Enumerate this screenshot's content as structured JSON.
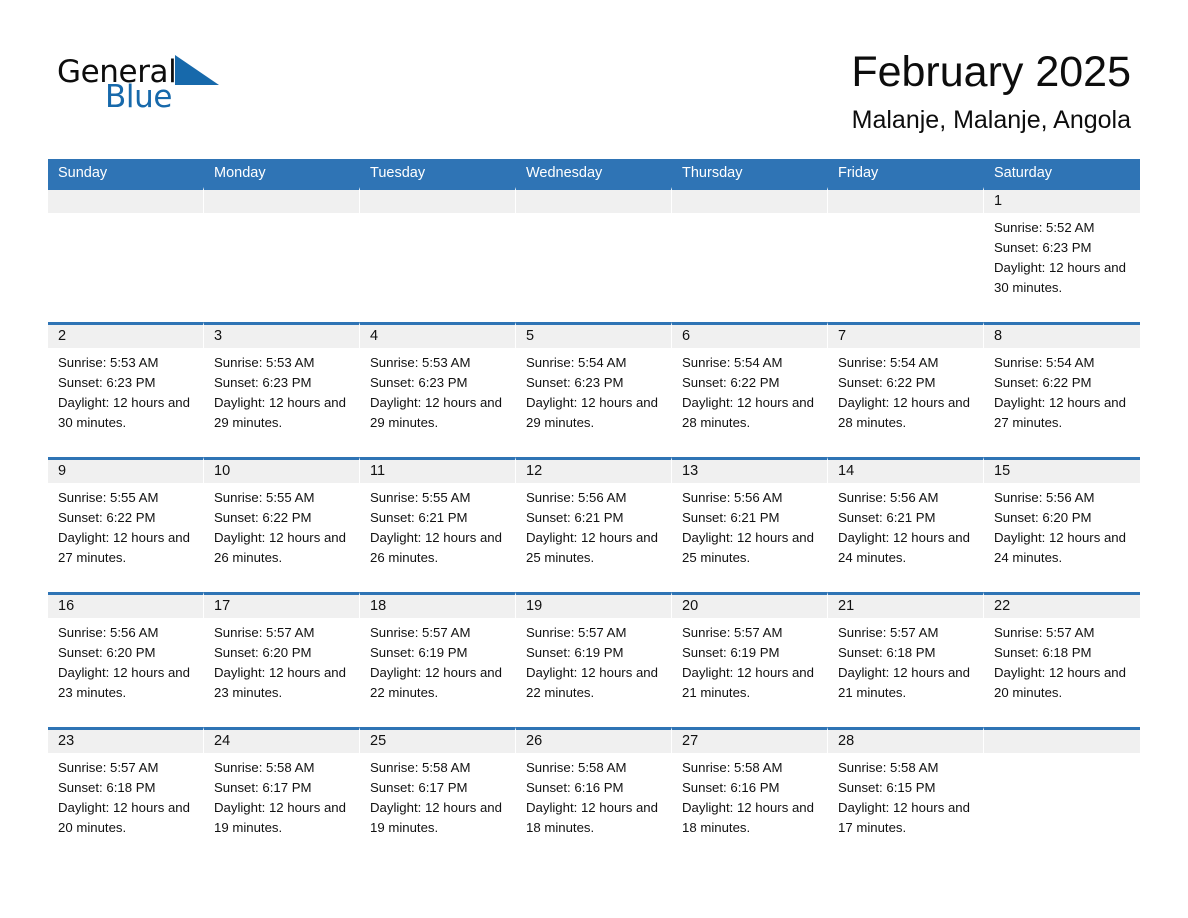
{
  "brand": {
    "name_part1": "General",
    "name_part2": "Blue",
    "triangle_color": "#1769ab"
  },
  "header": {
    "month_title": "February 2025",
    "location": "Malanje, Malanje, Angola"
  },
  "theme": {
    "header_blue": "#2f74b5",
    "day_band_gray": "#f0f0f0",
    "text_color": "#111111"
  },
  "weekdays": [
    "Sunday",
    "Monday",
    "Tuesday",
    "Wednesday",
    "Thursday",
    "Friday",
    "Saturday"
  ],
  "weeks": [
    [
      {
        "day": "",
        "sunrise": "",
        "sunset": "",
        "daylight": ""
      },
      {
        "day": "",
        "sunrise": "",
        "sunset": "",
        "daylight": ""
      },
      {
        "day": "",
        "sunrise": "",
        "sunset": "",
        "daylight": ""
      },
      {
        "day": "",
        "sunrise": "",
        "sunset": "",
        "daylight": ""
      },
      {
        "day": "",
        "sunrise": "",
        "sunset": "",
        "daylight": ""
      },
      {
        "day": "",
        "sunrise": "",
        "sunset": "",
        "daylight": ""
      },
      {
        "day": "1",
        "sunrise": "Sunrise: 5:52 AM",
        "sunset": "Sunset: 6:23 PM",
        "daylight": "Daylight: 12 hours and 30 minutes."
      }
    ],
    [
      {
        "day": "2",
        "sunrise": "Sunrise: 5:53 AM",
        "sunset": "Sunset: 6:23 PM",
        "daylight": "Daylight: 12 hours and 30 minutes."
      },
      {
        "day": "3",
        "sunrise": "Sunrise: 5:53 AM",
        "sunset": "Sunset: 6:23 PM",
        "daylight": "Daylight: 12 hours and 29 minutes."
      },
      {
        "day": "4",
        "sunrise": "Sunrise: 5:53 AM",
        "sunset": "Sunset: 6:23 PM",
        "daylight": "Daylight: 12 hours and 29 minutes."
      },
      {
        "day": "5",
        "sunrise": "Sunrise: 5:54 AM",
        "sunset": "Sunset: 6:23 PM",
        "daylight": "Daylight: 12 hours and 29 minutes."
      },
      {
        "day": "6",
        "sunrise": "Sunrise: 5:54 AM",
        "sunset": "Sunset: 6:22 PM",
        "daylight": "Daylight: 12 hours and 28 minutes."
      },
      {
        "day": "7",
        "sunrise": "Sunrise: 5:54 AM",
        "sunset": "Sunset: 6:22 PM",
        "daylight": "Daylight: 12 hours and 28 minutes."
      },
      {
        "day": "8",
        "sunrise": "Sunrise: 5:54 AM",
        "sunset": "Sunset: 6:22 PM",
        "daylight": "Daylight: 12 hours and 27 minutes."
      }
    ],
    [
      {
        "day": "9",
        "sunrise": "Sunrise: 5:55 AM",
        "sunset": "Sunset: 6:22 PM",
        "daylight": "Daylight: 12 hours and 27 minutes."
      },
      {
        "day": "10",
        "sunrise": "Sunrise: 5:55 AM",
        "sunset": "Sunset: 6:22 PM",
        "daylight": "Daylight: 12 hours and 26 minutes."
      },
      {
        "day": "11",
        "sunrise": "Sunrise: 5:55 AM",
        "sunset": "Sunset: 6:21 PM",
        "daylight": "Daylight: 12 hours and 26 minutes."
      },
      {
        "day": "12",
        "sunrise": "Sunrise: 5:56 AM",
        "sunset": "Sunset: 6:21 PM",
        "daylight": "Daylight: 12 hours and 25 minutes."
      },
      {
        "day": "13",
        "sunrise": "Sunrise: 5:56 AM",
        "sunset": "Sunset: 6:21 PM",
        "daylight": "Daylight: 12 hours and 25 minutes."
      },
      {
        "day": "14",
        "sunrise": "Sunrise: 5:56 AM",
        "sunset": "Sunset: 6:21 PM",
        "daylight": "Daylight: 12 hours and 24 minutes."
      },
      {
        "day": "15",
        "sunrise": "Sunrise: 5:56 AM",
        "sunset": "Sunset: 6:20 PM",
        "daylight": "Daylight: 12 hours and 24 minutes."
      }
    ],
    [
      {
        "day": "16",
        "sunrise": "Sunrise: 5:56 AM",
        "sunset": "Sunset: 6:20 PM",
        "daylight": "Daylight: 12 hours and 23 minutes."
      },
      {
        "day": "17",
        "sunrise": "Sunrise: 5:57 AM",
        "sunset": "Sunset: 6:20 PM",
        "daylight": "Daylight: 12 hours and 23 minutes."
      },
      {
        "day": "18",
        "sunrise": "Sunrise: 5:57 AM",
        "sunset": "Sunset: 6:19 PM",
        "daylight": "Daylight: 12 hours and 22 minutes."
      },
      {
        "day": "19",
        "sunrise": "Sunrise: 5:57 AM",
        "sunset": "Sunset: 6:19 PM",
        "daylight": "Daylight: 12 hours and 22 minutes."
      },
      {
        "day": "20",
        "sunrise": "Sunrise: 5:57 AM",
        "sunset": "Sunset: 6:19 PM",
        "daylight": "Daylight: 12 hours and 21 minutes."
      },
      {
        "day": "21",
        "sunrise": "Sunrise: 5:57 AM",
        "sunset": "Sunset: 6:18 PM",
        "daylight": "Daylight: 12 hours and 21 minutes."
      },
      {
        "day": "22",
        "sunrise": "Sunrise: 5:57 AM",
        "sunset": "Sunset: 6:18 PM",
        "daylight": "Daylight: 12 hours and 20 minutes."
      }
    ],
    [
      {
        "day": "23",
        "sunrise": "Sunrise: 5:57 AM",
        "sunset": "Sunset: 6:18 PM",
        "daylight": "Daylight: 12 hours and 20 minutes."
      },
      {
        "day": "24",
        "sunrise": "Sunrise: 5:58 AM",
        "sunset": "Sunset: 6:17 PM",
        "daylight": "Daylight: 12 hours and 19 minutes."
      },
      {
        "day": "25",
        "sunrise": "Sunrise: 5:58 AM",
        "sunset": "Sunset: 6:17 PM",
        "daylight": "Daylight: 12 hours and 19 minutes."
      },
      {
        "day": "26",
        "sunrise": "Sunrise: 5:58 AM",
        "sunset": "Sunset: 6:16 PM",
        "daylight": "Daylight: 12 hours and 18 minutes."
      },
      {
        "day": "27",
        "sunrise": "Sunrise: 5:58 AM",
        "sunset": "Sunset: 6:16 PM",
        "daylight": "Daylight: 12 hours and 18 minutes."
      },
      {
        "day": "28",
        "sunrise": "Sunrise: 5:58 AM",
        "sunset": "Sunset: 6:15 PM",
        "daylight": "Daylight: 12 hours and 17 minutes."
      },
      {
        "day": "",
        "sunrise": "",
        "sunset": "",
        "daylight": ""
      }
    ]
  ]
}
